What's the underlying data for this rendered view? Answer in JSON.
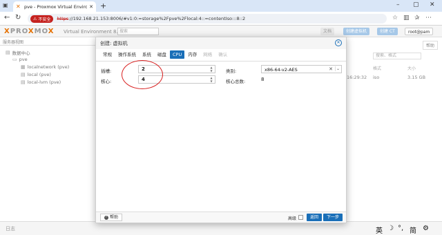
{
  "browser": {
    "tab_title": "pve - Proxmox Virtual Environment",
    "insecure_label": "不安全",
    "url_scheme": "https",
    "url_rest": "://192.168.21.153:8006/#v1:0:=storage%2Fpve%2Flocal:4::=contentIso:::8::2"
  },
  "app": {
    "logo_left": "PRO",
    "logo_x": "X",
    "logo_mid": "MO",
    "logo_right": "X",
    "version": "Virtual Environment 8.4.0",
    "search_placeholder": "搜索",
    "docs_label": "文档",
    "create_vm_label": "创建虚拟机",
    "create_ct_label": "创建 CT",
    "user_label": "root@pam"
  },
  "sidebar": {
    "view_label": "服务器视图",
    "tree": [
      {
        "label": "数据中心"
      },
      {
        "label": "pve"
      },
      {
        "label": "localnetwork (pve)"
      },
      {
        "label": "local (pve)"
      },
      {
        "label": "local-lvm (pve)"
      }
    ]
  },
  "main": {
    "help_label": "帮助",
    "filter_placeholder": "搜索、格式",
    "col_format": "格式",
    "col_size": "大小",
    "row_date": "16:29:32",
    "row_format": "iso",
    "row_size": "3.15 GB"
  },
  "log": {
    "label": "日志"
  },
  "ime": {
    "lang": "英",
    "moon": "☽",
    "dot": "°,",
    "mode": "简",
    "gear": "⚙"
  },
  "dialog": {
    "title": "创建: 虚拟机",
    "tabs": [
      {
        "label": "常规",
        "state": "normal"
      },
      {
        "label": "操作系统",
        "state": "normal"
      },
      {
        "label": "系统",
        "state": "normal"
      },
      {
        "label": "磁盘",
        "state": "normal"
      },
      {
        "label": "CPU",
        "state": "active"
      },
      {
        "label": "内存",
        "state": "normal"
      },
      {
        "label": "网络",
        "state": "disabled"
      },
      {
        "label": "确认",
        "state": "disabled"
      }
    ],
    "sockets_label": "插槽:",
    "sockets_value": "2",
    "cores_label": "核心:",
    "cores_value": "4",
    "type_label": "类别:",
    "type_value": "x86-64-v2-AES",
    "total_cores_label": "核心总数:",
    "total_cores_value": "8",
    "help_button": "帮助",
    "advanced_label": "高级",
    "back_button": "返回",
    "next_button": "下一步"
  },
  "colors": {
    "accent": "#1a6fb8",
    "brand_orange": "#e57000",
    "annotation": "#d81e1e"
  }
}
